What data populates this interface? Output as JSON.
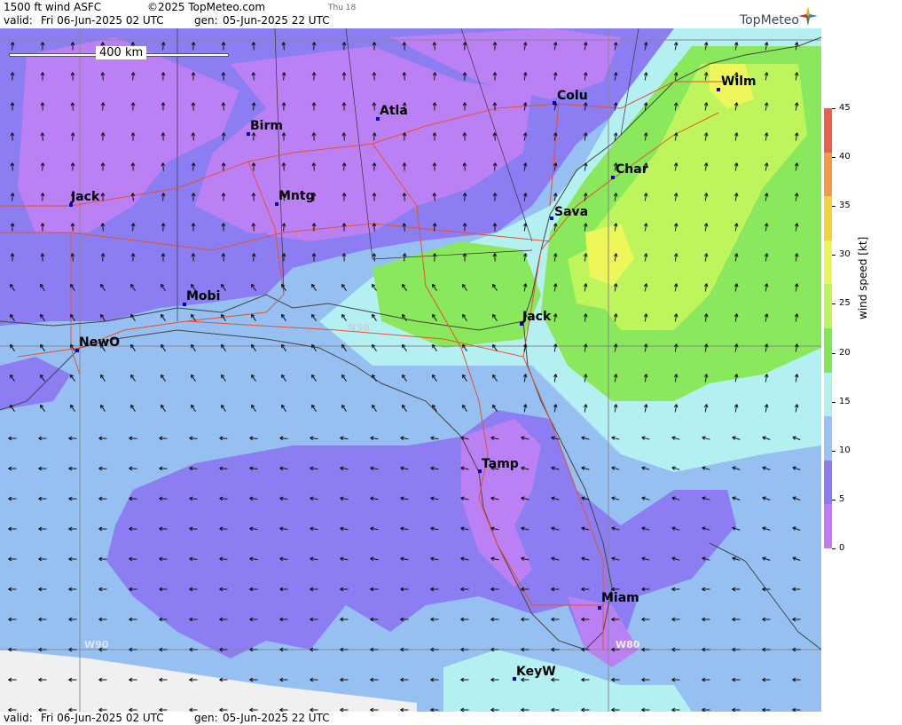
{
  "header": {
    "product": "1500 ft wind ASFC",
    "copyright": "©2025 TopMeteo.com",
    "day": "Thu 18",
    "valid_label": "valid:",
    "valid": "Fri  06-Jun-2025  02 UTC",
    "gen_label": "gen:",
    "gen": "05-Jun-2025 22 UTC"
  },
  "footer": {
    "valid_label": "valid:",
    "valid": "Fri  06-Jun-2025  02 UTC",
    "gen_label": "gen:",
    "gen": "05-Jun-2025 22 UTC"
  },
  "logo": {
    "text": "TopMeteo"
  },
  "scale_bar": {
    "label": "400 km"
  },
  "legend": {
    "units": "wind speed [kt]",
    "ticks": [
      "45",
      "40",
      "35",
      "30",
      "25",
      "20",
      "15",
      "10",
      "5",
      "0"
    ],
    "colors": [
      "#e8604a",
      "#f39a4a",
      "#f5d23a",
      "#e9f45a",
      "#bff55a",
      "#7ee85a",
      "#b3f0f0",
      "#99c2f5",
      "#8a7cf0",
      "#c07cf5"
    ]
  },
  "grid_labels": {
    "lat30": "N30",
    "lon90": "W90",
    "lon80": "W80"
  },
  "cities": [
    {
      "name": "Jack",
      "id": "jack-ms"
    },
    {
      "name": "Birm",
      "id": "birm"
    },
    {
      "name": "Atla",
      "id": "atla"
    },
    {
      "name": "Colu",
      "id": "colu"
    },
    {
      "name": "Wilm",
      "id": "wilm"
    },
    {
      "name": "Mntg",
      "id": "mntg"
    },
    {
      "name": "Char",
      "id": "char"
    },
    {
      "name": "Sava",
      "id": "sava"
    },
    {
      "name": "Mobi",
      "id": "mobi"
    },
    {
      "name": "Jack",
      "id": "jack-fl"
    },
    {
      "name": "NewO",
      "id": "newo"
    },
    {
      "name": "Tamp",
      "id": "tamp"
    },
    {
      "name": "Miam",
      "id": "miam"
    },
    {
      "name": "KeyW",
      "id": "keyw"
    }
  ],
  "colors": {
    "land_lines": "#444444",
    "roads": "#e8502a",
    "grid": "#888888"
  }
}
